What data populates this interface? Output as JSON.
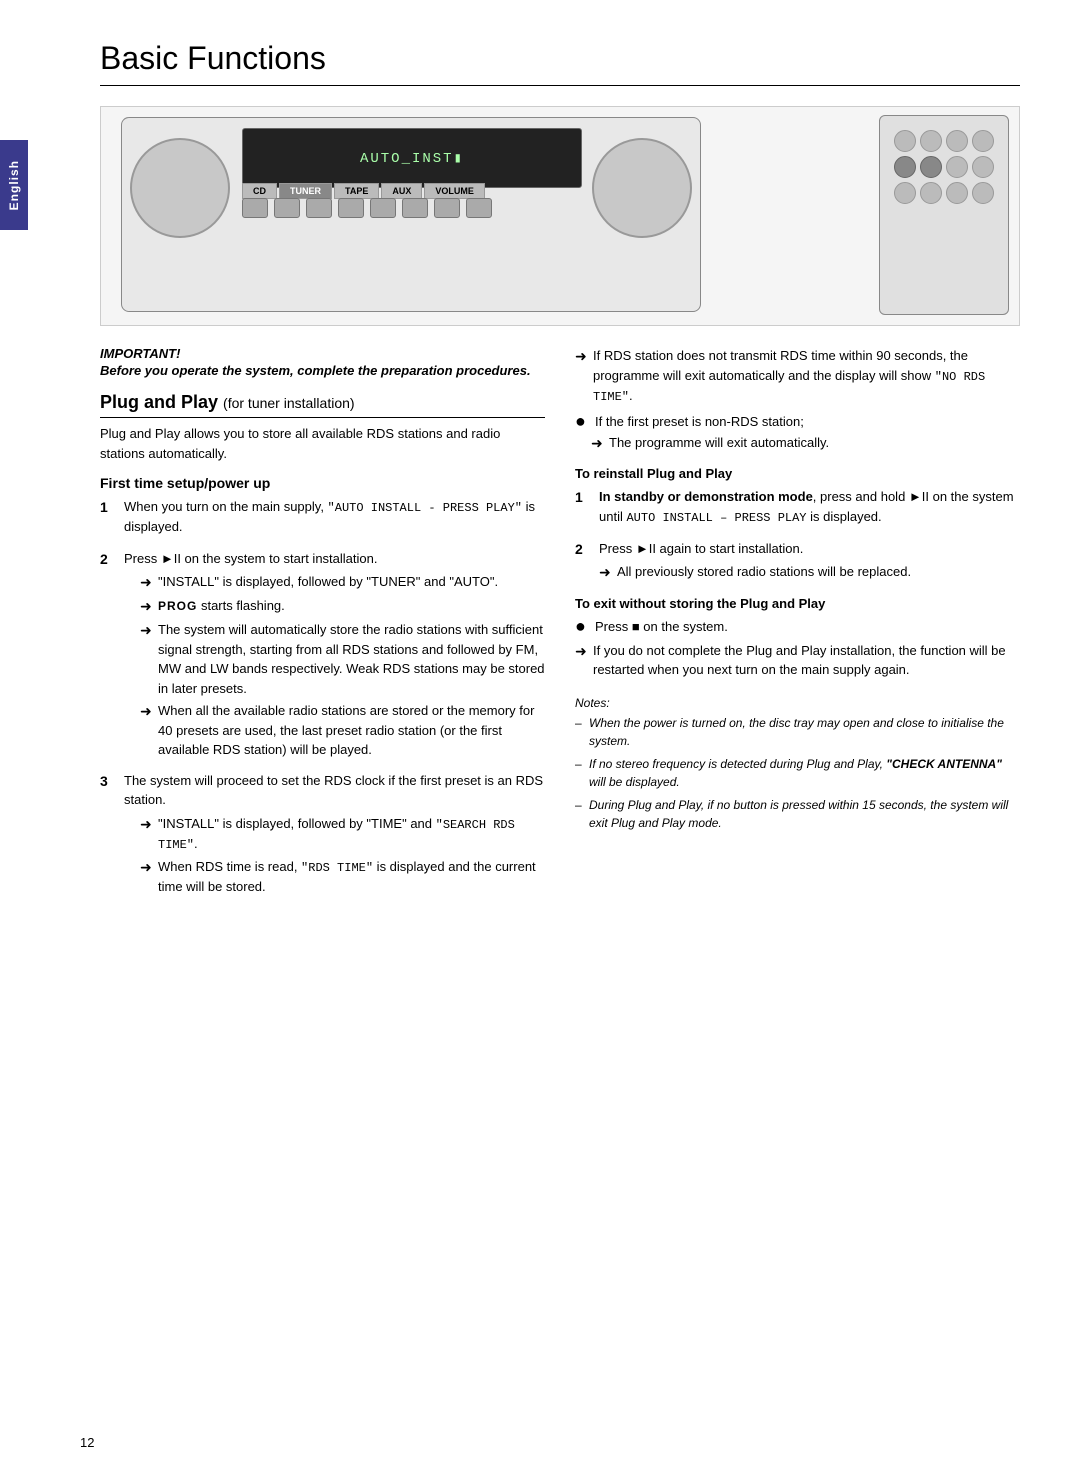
{
  "page": {
    "title": "Basic Functions",
    "number": "12",
    "side_tab_label": "English"
  },
  "important": {
    "label": "IMPORTANT!",
    "body": "Before you operate the system, complete the preparation procedures."
  },
  "plug_and_play": {
    "heading": "Plug and Play",
    "sub_label": "(for tuner installation)",
    "description": "Plug and Play allows you to store all available RDS stations and radio stations automatically.",
    "first_time_heading": "First time setup/power up",
    "steps": [
      {
        "num": "1",
        "text": "When you turn on the main supply, ",
        "mono": "AUTO INSTALL - PRESS PLAY",
        "text2": " is displayed."
      },
      {
        "num": "2",
        "text": "Press ►II on the system to start installation.",
        "arrows": [
          "\"INSTALL\" is displayed, followed by \"TUNER\" and \"AUTO\".",
          "PROG starts flashing.",
          "The system will automatically store the radio stations with sufficient signal strength, starting from all RDS stations and followed by FM, MW and LW bands respectively. Weak RDS stations may be stored in later presets.",
          "When all the available radio stations are stored or the memory for 40 presets are used, the last preset radio station (or the first available RDS station) will be played."
        ]
      },
      {
        "num": "3",
        "text": "The system will proceed to set the RDS clock if the first preset is an RDS station.",
        "arrows": [
          "\"INSTALL\" is displayed, followed by \"TIME\" and \"SEARCH RDS TIME\".",
          "When RDS time is read, \"RDS TIME\" is displayed and the current time will be stored."
        ]
      }
    ]
  },
  "right_col": {
    "rds_note_arrows": [
      "If RDS station does not transmit RDS time within 90 seconds, the programme will exit automatically and the display will show \"NO RDS TIME\".",
      "If the first preset is non-RDS station;",
      "The programme will exit automatically."
    ],
    "reinstall_heading": "To reinstall Plug and Play",
    "reinstall_steps": [
      {
        "num": "1",
        "bold_start": "In standby or demonstration mode",
        "text": ", press and hold ►II on the system until ",
        "mono": "AUTO INSTALL – PRESS PLAY",
        "text2": " is displayed."
      },
      {
        "num": "2",
        "text": "Press ►II again to start installation.",
        "arrows": [
          "All previously stored radio stations will be replaced."
        ]
      }
    ],
    "exit_heading": "To exit without storing the Plug and Play",
    "exit_bullet": "Press ■ on the system.",
    "exit_arrow": "If you do not complete the Plug and Play installation, the function will be restarted when you next turn on the main supply again.",
    "notes_title": "Notes:",
    "notes": [
      "When the power is turned on, the disc tray may open and close to initialise the system.",
      "If no stereo frequency is detected during Plug and Play, \"CHECK ANTENNA\" will be displayed.",
      "During Plug and Play, if no button is pressed within 15 seconds, the system will exit Plug and Play mode."
    ]
  },
  "display": {
    "screen_text": "AUTO_INST▮"
  }
}
